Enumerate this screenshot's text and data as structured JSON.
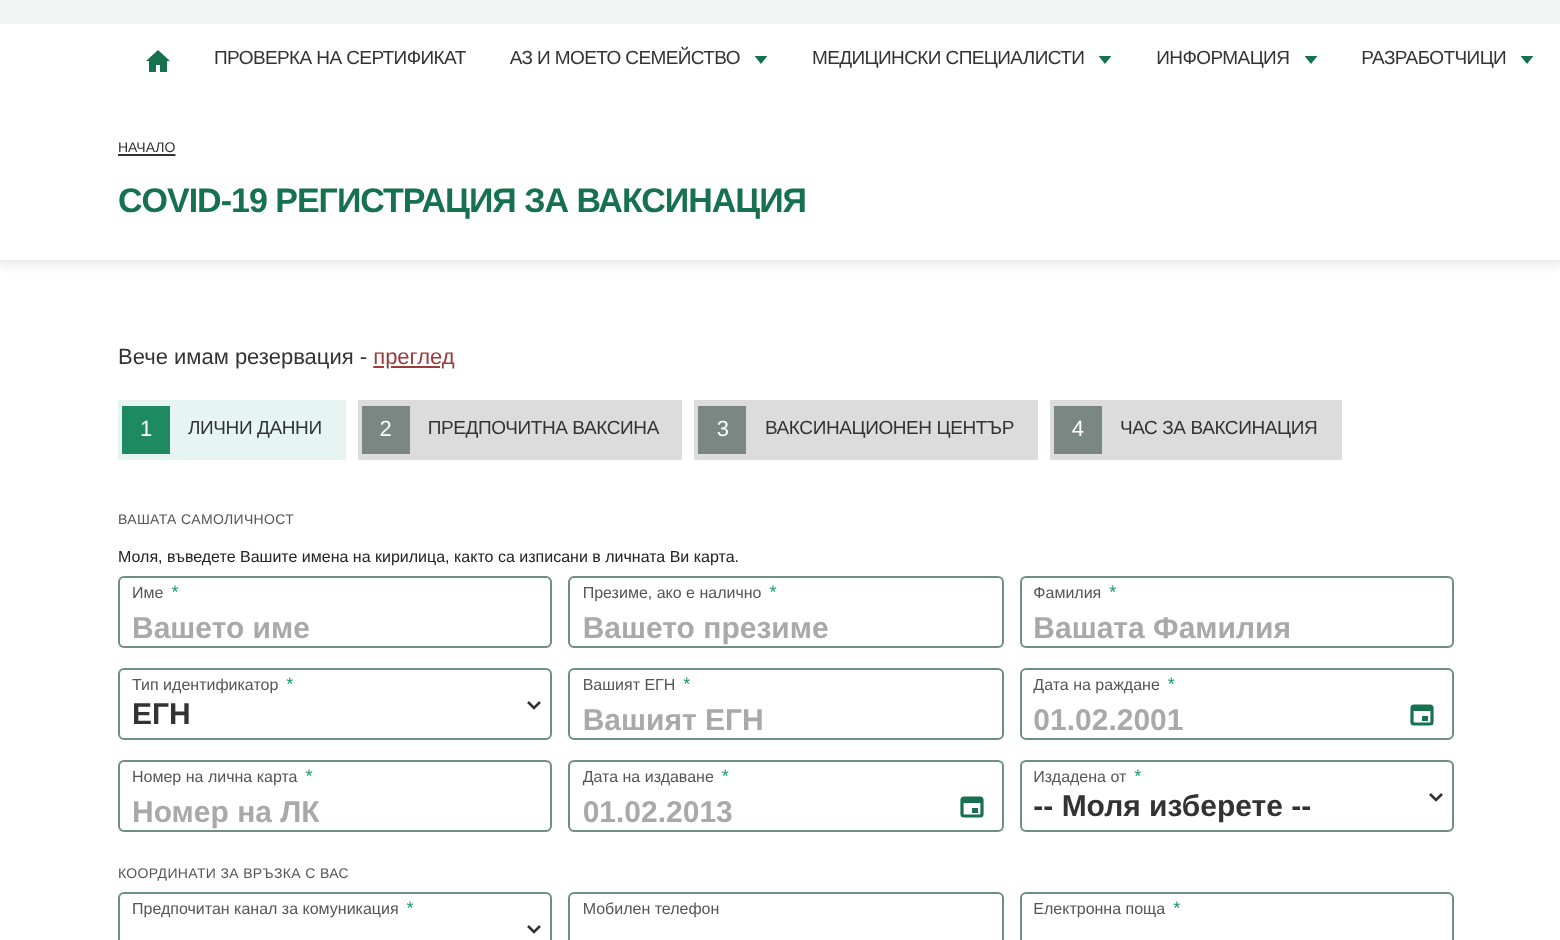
{
  "nav": {
    "items": [
      {
        "label": "ПРОВЕРКА НА СЕРТИФИКАТ",
        "dropdown": false
      },
      {
        "label": "АЗ И МОЕТО СЕМЕЙСТВО",
        "dropdown": true
      },
      {
        "label": "МЕДИЦИНСКИ СПЕЦИАЛИСТИ",
        "dropdown": true
      },
      {
        "label": "ИНФОРМАЦИЯ",
        "dropdown": true
      },
      {
        "label": "РАЗРАБОТЧИЦИ",
        "dropdown": true
      }
    ]
  },
  "breadcrumb": "НАЧАЛО",
  "title": "COVID-19 РЕГИСТРАЦИЯ ЗА ВАКСИНАЦИЯ",
  "reservation": {
    "text": "Вече имам резервация - ",
    "link": "преглед"
  },
  "steps": [
    {
      "number": "1",
      "label": "ЛИЧНИ ДАННИ",
      "selected": true
    },
    {
      "number": "2",
      "label": "ПРЕДПОЧИТНА ВАКСИНА",
      "selected": false
    },
    {
      "number": "3",
      "label": "ВАКСИНАЦИОНЕН ЦЕНТЪР",
      "selected": false
    },
    {
      "number": "4",
      "label": "ЧАС ЗА ВАКСИНАЦИЯ",
      "selected": false
    }
  ],
  "sections": [
    {
      "heading": "ВАШАТА САМОЛИЧНОСТ",
      "note": "Моля, въведете Вашите имена на кирилица, както са изписани в личната Ви карта.",
      "fields": [
        {
          "kind": "text",
          "label": "Име",
          "required_mark": "*",
          "placeholder": "Вашето име"
        },
        {
          "kind": "text",
          "label": "Презиме, ако е налично",
          "required_mark": "*",
          "placeholder": "Вашето презиме"
        },
        {
          "kind": "text",
          "label": "Фамилия",
          "required_mark": "*",
          "placeholder": "Вашата Фамилия"
        },
        {
          "kind": "select",
          "label": "Тип идентификатор",
          "required_mark": "*",
          "value": "ЕГН"
        },
        {
          "kind": "text",
          "label": "Вашият ЕГН",
          "required_mark": "*",
          "placeholder": "Вашият ЕГН"
        },
        {
          "kind": "date",
          "label": "Дата на раждане",
          "required_mark": "*",
          "placeholder": "01.02.2001"
        },
        {
          "kind": "text",
          "label": "Номер на лична карта",
          "required_mark": "*",
          "placeholder": "Номер на ЛК"
        },
        {
          "kind": "date",
          "label": "Дата на издаване",
          "required_mark": "*",
          "placeholder": "01.02.2013"
        },
        {
          "kind": "select",
          "label": "Издадена от",
          "required_mark": "*",
          "value": "-- Моля изберете --"
        }
      ]
    },
    {
      "heading": "КООРДИНАТИ ЗА ВРЪЗКА С ВАС",
      "fields": [
        {
          "kind": "select",
          "label": "Предпочитан канал за комуникация",
          "required_mark": "*"
        },
        {
          "kind": "text",
          "label": "Мобилен телефон"
        },
        {
          "kind": "text",
          "label": "Електронна поща",
          "required_mark": "*"
        }
      ]
    }
  ]
}
